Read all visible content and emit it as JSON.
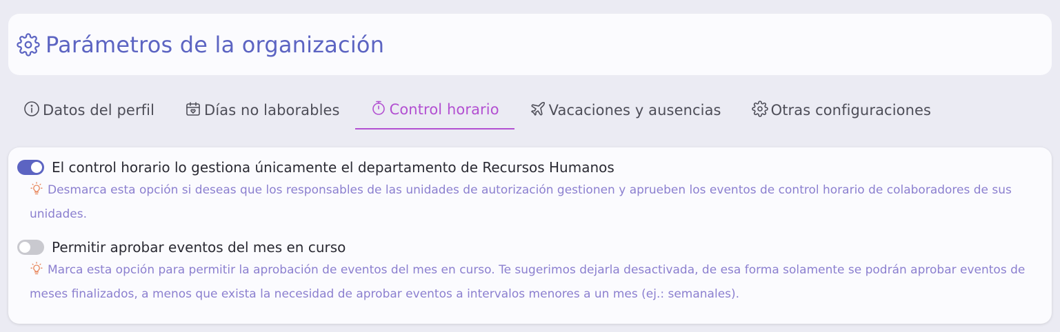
{
  "header": {
    "icon": "gear-icon",
    "title": "Parámetros de la organización"
  },
  "tabs": [
    {
      "label": "Datos del perfil",
      "icon": "info-icon",
      "active": false
    },
    {
      "label": "Días no laborables",
      "icon": "calendar-icon",
      "active": false
    },
    {
      "label": "Control horario",
      "icon": "stopwatch-icon",
      "active": true
    },
    {
      "label": "Vacaciones y ausencias",
      "icon": "airplane-icon",
      "active": false
    },
    {
      "label": "Otras configuraciones",
      "icon": "gear-icon",
      "active": false
    }
  ],
  "settings": [
    {
      "label": "El control horario lo gestiona únicamente el departamento de Recursos Humanos",
      "enabled": true,
      "hint": "Desmarca esta opción si deseas que los responsables de las unidades de autorización gestionen y aprueben los eventos de control horario de colaboradores de sus unidades."
    },
    {
      "label": "Permitir aprobar eventos del mes en curso",
      "enabled": false,
      "hint": "Marca esta opción para permitir la aprobación de eventos del mes en curso. Te sugerimos dejarla desactivada, de esa forma solamente se podrán aprobar eventos de meses finalizados, a menos que exista la necesidad de aprobar eventos a intervalos menores a un mes (ej.: semanales)."
    }
  ],
  "colors": {
    "accent": "#5c64c2",
    "active_tab": "#b24fd1",
    "hint_text": "#8b7fcf",
    "hint_icon": "#e8855a",
    "background": "#ebebf3"
  }
}
